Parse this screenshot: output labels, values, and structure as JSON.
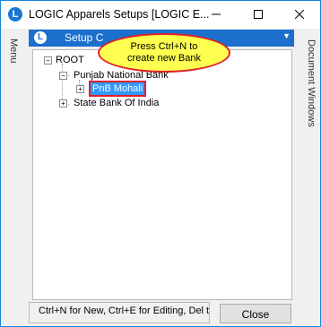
{
  "window": {
    "title": "LOGIC Apparels Setups  [LOGIC E...",
    "app_icon_glyph": "L",
    "minimize_icon": "minimize-icon",
    "maximize_icon": "maximize-icon",
    "close_icon": "close-icon"
  },
  "side_panels": {
    "left_label": "Menu",
    "right_label": "Document Windows"
  },
  "panel": {
    "title": "Setup C",
    "icon_glyph": "L",
    "chevron": "▼"
  },
  "tree": {
    "root_label": "ROOT",
    "root_expander": "−",
    "items": [
      {
        "label": "Punjab National Bank",
        "expander": "−"
      },
      {
        "label": "PnB Mohali",
        "expander": "+",
        "selected": true
      },
      {
        "label": "State Bank Of India",
        "expander": "+"
      }
    ]
  },
  "callout": {
    "line1": "Press  Ctrl+N  to",
    "line2": "create  new  Bank"
  },
  "status": {
    "text": "Ctrl+N for New, Ctrl+E for Editing, Del to"
  },
  "buttons": {
    "close_label": "Close"
  },
  "colors": {
    "accent": "#1c6fcc",
    "selection": "#3399ff",
    "callout_fill": "#ffff4f",
    "callout_border": "#e0202a"
  }
}
